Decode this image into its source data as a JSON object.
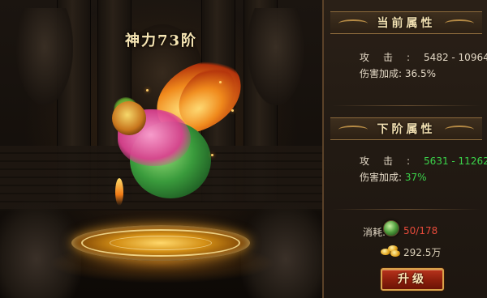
{
  "scene": {
    "title": "神力73阶"
  },
  "current_attributes": {
    "header": "当前属性",
    "rows": [
      {
        "label": "攻击:",
        "value": "5482 - 10964"
      },
      {
        "label": "伤害加成:",
        "value": "36.5%"
      }
    ]
  },
  "next_attributes": {
    "header": "下阶属性",
    "rows": [
      {
        "label": "攻击:",
        "value": "5631 - 11262"
      },
      {
        "label": "伤害加成:",
        "value": "37%"
      }
    ]
  },
  "cost": {
    "label": "消耗:",
    "item_icon": "green-orb-icon",
    "item_amount": "50/178",
    "gold_icon": "gold-ingot-icon",
    "gold_amount": "292.5万"
  },
  "upgrade_button": {
    "label": "升级"
  },
  "colors": {
    "next_value": "#3bd34a",
    "insufficient": "#e64a3a",
    "button": "#8c1e0c",
    "gold_trim": "#d8a24a"
  }
}
